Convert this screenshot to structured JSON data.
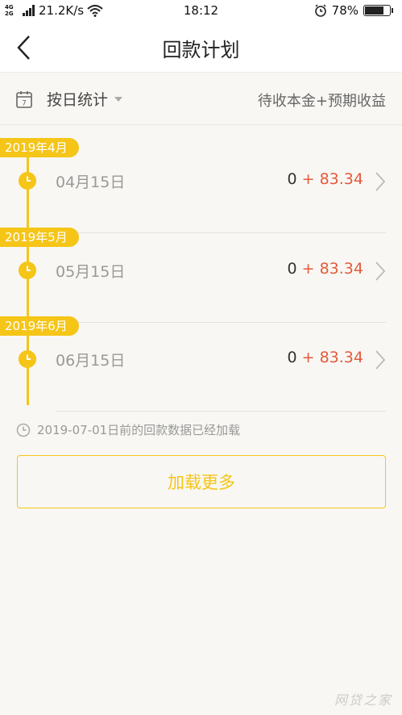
{
  "status_bar": {
    "network_type": "4G 2G",
    "speed": "21.2K/s",
    "time": "18:12",
    "battery_percent": "78%",
    "battery_level": 0.78,
    "icons": [
      "signal-icon",
      "wifi-icon",
      "alarm-icon",
      "battery-icon"
    ]
  },
  "header": {
    "title": "回款计划",
    "back_icon": "chevron-left-icon"
  },
  "filter": {
    "mode_label": "按日统计",
    "column_label": "待收本金+预期收益",
    "calendar_icon_day": "7"
  },
  "schedule": [
    {
      "month": "2019年4月",
      "date": "04月15日",
      "principal": "0",
      "interest": " + 83.34"
    },
    {
      "month": "2019年5月",
      "date": "05月15日",
      "principal": "0",
      "interest": " + 83.34"
    },
    {
      "month": "2019年6月",
      "date": "06月15日",
      "principal": "0",
      "interest": " + 83.34"
    }
  ],
  "footer": {
    "note": "2019-07-01日前的回款数据已经加载",
    "load_more_label": "加载更多",
    "watermark": "网贷之家"
  },
  "colors": {
    "accent": "#f5c518",
    "interest": "#e45a3c",
    "background": "#f8f7f3"
  }
}
